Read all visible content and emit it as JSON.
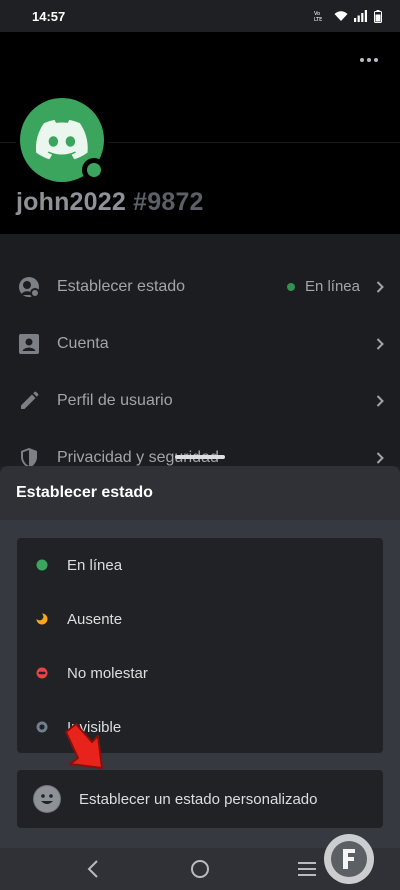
{
  "status_bar": {
    "time": "14:57",
    "icons": [
      "volte-icon",
      "wifi-icon",
      "signal-icon",
      "battery-icon"
    ],
    "volte_text": "Vo LTE"
  },
  "profile": {
    "username": "john2022",
    "discriminator": "#9872",
    "status_color": "#3ba55d"
  },
  "settings": {
    "items": [
      {
        "label": "Establecer estado",
        "value": "En línea",
        "icon": "status-icon"
      },
      {
        "label": "Cuenta",
        "icon": "account-icon"
      },
      {
        "label": "Perfil de usuario",
        "icon": "pencil-icon"
      },
      {
        "label": "Privacidad y seguridad",
        "icon": "shield-icon"
      }
    ]
  },
  "sheet": {
    "title": "Establecer estado",
    "options": [
      {
        "label": "En línea",
        "color": "#3ba55d",
        "icon": "online-dot-icon"
      },
      {
        "label": "Ausente",
        "color": "#faa81a",
        "icon": "idle-moon-icon"
      },
      {
        "label": "No molestar",
        "color": "#ed4245",
        "icon": "dnd-icon"
      },
      {
        "label": "Invisible",
        "color": "#747f8d",
        "icon": "invisible-icon"
      }
    ],
    "custom_status": "Establecer un estado personalizado"
  },
  "nav": {
    "icons": [
      "back-icon",
      "home-icon",
      "menu-icon"
    ]
  },
  "colors": {
    "accent": "#3ba55d",
    "arrow": "#e8231c"
  }
}
